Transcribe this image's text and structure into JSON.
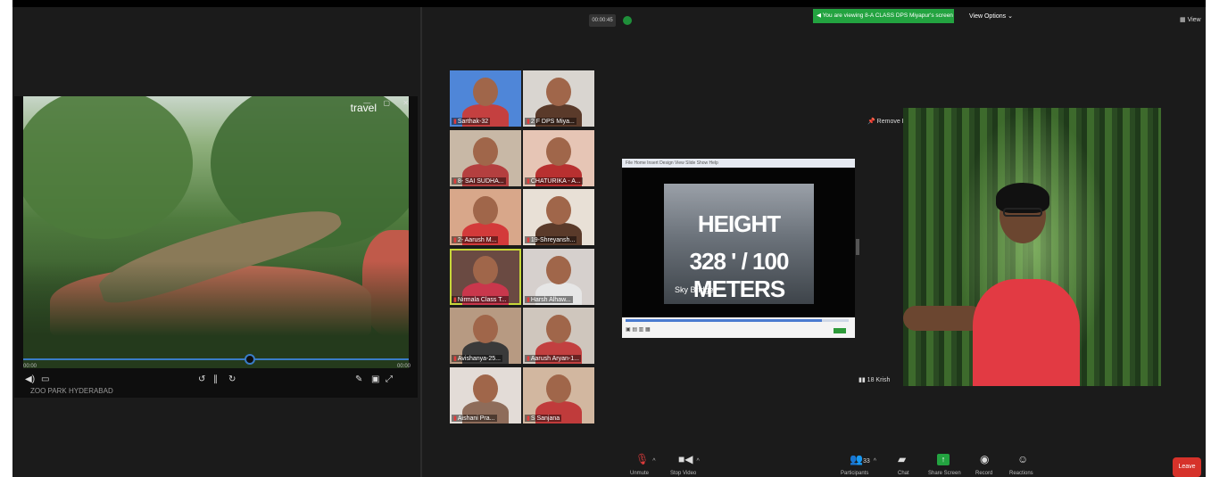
{
  "left_video": {
    "brand": "travel",
    "time_elapsed": "00:00",
    "time_total": "00:00",
    "caption": "ZOO PARK HYDERABAD"
  },
  "gallery": {
    "timer": "00:00:45",
    "tiles": [
      {
        "label": "Sarthak-32",
        "bg": "#4f86d8",
        "shirt": "#c44040"
      },
      {
        "label": "2 F DPS Miya...",
        "bg": "#d9d5d0",
        "shirt": "#5a3a2a"
      },
      {
        "label": "8- SAI SUDHA...",
        "bg": "#c8b8a6",
        "shirt": "#b43f3f"
      },
      {
        "label": "CHATURIKA - A...",
        "bg": "#e6c5b5",
        "shirt": "#b83030"
      },
      {
        "label": "2- Aarush M...",
        "bg": "#d8a78a",
        "shirt": "#d33a3a"
      },
      {
        "label": "19-Shreyansh...",
        "bg": "#e8e0d6",
        "shirt": "#5a3a2a"
      },
      {
        "label": "Nirmala Class T...",
        "bg": "#6a4a42",
        "shirt": "#c9374c"
      },
      {
        "label": "Harsh Alhaw...",
        "bg": "#d6d0cd",
        "shirt": "#e6e6e6"
      },
      {
        "label": "Avishanya-25...",
        "bg": "#b79a82",
        "shirt": "#3a3a3a"
      },
      {
        "label": "Aarush Aryan-1...",
        "bg": "#cfc6bd",
        "shirt": "#c24040"
      },
      {
        "label": "Aishani Pra...",
        "bg": "#e3dcd7",
        "shirt": "#8e6c5a"
      },
      {
        "label": "S Sanjana",
        "bg": "#d2b7a0",
        "shirt": "#c03b3b"
      }
    ]
  },
  "shared_screen": {
    "line1": "HEIGHT",
    "line2": "328 ' / 100 METERS",
    "line3": "Sky Bridge"
  },
  "banner": {
    "viewing": "You are viewing 8-A CLASS DPS Miyapur's screen",
    "view_options": "View Options",
    "view": "View"
  },
  "speaker": {
    "remove_pin": "Remove Pin",
    "name": "18 Krish"
  },
  "toolbar": {
    "unmute": "Unmute",
    "stop_video": "Stop Video",
    "participants": "Participants",
    "participants_count": "33",
    "chat": "Chat",
    "share_screen": "Share Screen",
    "record": "Record",
    "reactions": "Reactions",
    "leave": "Leave"
  }
}
